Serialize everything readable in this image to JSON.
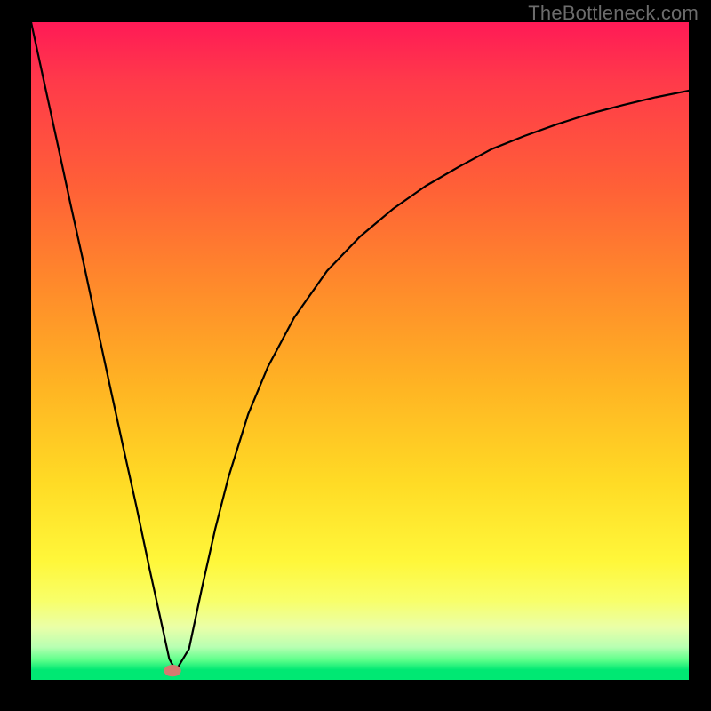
{
  "watermark": "TheBottleneck.com",
  "chart_data": {
    "type": "line",
    "title": "",
    "xlabel": "",
    "ylabel": "",
    "xlim": [
      0,
      100
    ],
    "ylim": [
      0,
      100
    ],
    "grid": false,
    "legend": null,
    "series": [
      {
        "name": "curve",
        "x": [
          0,
          2,
          4,
          6,
          8,
          10,
          12,
          14,
          16,
          18,
          20,
          21,
          22,
          24,
          26,
          28,
          30,
          33,
          36,
          40,
          45,
          50,
          55,
          60,
          65,
          70,
          75,
          80,
          85,
          90,
          95,
          100
        ],
        "y": [
          100,
          90.8,
          81.6,
          72.3,
          63.3,
          53.9,
          44.6,
          35.4,
          26.4,
          16.9,
          7.8,
          3.2,
          1.4,
          4.7,
          14.1,
          23.0,
          30.8,
          40.4,
          47.6,
          55.1,
          62.2,
          67.4,
          71.6,
          75.1,
          78.0,
          80.7,
          82.7,
          84.5,
          86.1,
          87.4,
          88.6,
          89.6
        ]
      }
    ],
    "marker": {
      "name": "optimal-point",
      "x": 21.5,
      "y": 1.4,
      "rx": 1.3,
      "ry": 0.9,
      "color": "#d77a70"
    },
    "background_gradient": {
      "direction": "top-to-bottom",
      "stops": [
        {
          "pos": 0,
          "color": "#ff1a56"
        },
        {
          "pos": 25,
          "color": "#ff6037"
        },
        {
          "pos": 55,
          "color": "#ffb323"
        },
        {
          "pos": 82,
          "color": "#fff73a"
        },
        {
          "pos": 95,
          "color": "#b8ffb2"
        },
        {
          "pos": 100,
          "color": "#00e873"
        }
      ]
    }
  }
}
